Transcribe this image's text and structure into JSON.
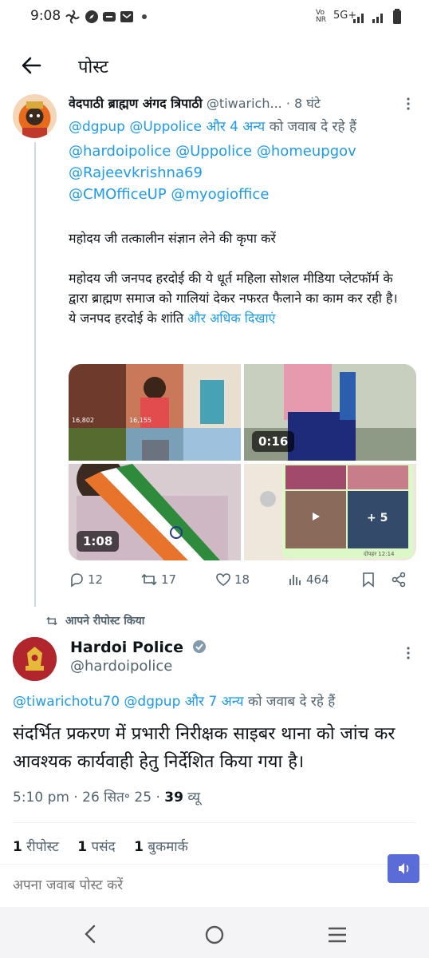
{
  "status_bar": {
    "time": "9:08",
    "network": "Vo\nNR",
    "signal_label": "5G+"
  },
  "header": {
    "title": "पोस्ट"
  },
  "tweet1": {
    "author_name": "वेदपाठी ब्राह्मण अंगद त्रिपाठी",
    "handle": "@tiwarich...",
    "time_ago": "· 8 घंटे",
    "replying_mentions": "@dgpup @Uppolice",
    "replying_more": "और 4 अन्य",
    "replying_suffix": "को जवाब दे रहे हैं",
    "mentions_line1": "@hardoipolice @Uppolice @homeupgov",
    "mentions_line2": "@Rajeevkrishna69",
    "mentions_line3": "@CMOfficeUP @myogioffice",
    "para1": "महोदय जी तत्कालीन संज्ञान लेने की कृपा करें",
    "para2": "महोदय जी जनपद हरदोई की ये धूर्त महिला सोशल मीडिया प्लेटफॉर्म के द्वारा ब्राह्मण समाज को गालियां देकर नफरत फैलाने का काम कर रही है।",
    "para3": "ये जनपद हरदोई के शांति",
    "show_more": "और अधिक दिखाएं",
    "media": {
      "video1_duration": "0:16",
      "video2_duration": "1:08",
      "thumb_views_a": "16,802",
      "thumb_views_b": "16,155",
      "chat_time": "दोपहर 12:14",
      "grid_more": "+ 5"
    },
    "stats": {
      "replies": "12",
      "reposts": "17",
      "likes": "18",
      "views": "464"
    }
  },
  "repost_label": "आपने रीपोस्ट किया",
  "tweet2": {
    "author_name": "Hardoi Police",
    "handle": "@hardoipolice",
    "replying_mentions": "@tiwarichotu70 @dgpup",
    "replying_more": "और 7 अन्य",
    "replying_suffix": "को जवाब दे रहे हैं",
    "body": "संदर्भित प्रकरण में प्रभारी निरीक्षक साइबर थाना को जांच कर आवश्यक कार्यवाही हेतु निर्देशित किया गया है।",
    "time": "5:10 pm",
    "date": "· 26 सित॰ 25 ·",
    "views_count": "39",
    "views_label": "व्यू",
    "reposts_count": "1",
    "reposts_label": "रीपोस्ट",
    "likes_count": "1",
    "likes_label": "पसंद",
    "bookmarks_count": "1",
    "bookmarks_label": "बुकमार्क"
  },
  "reply_box": {
    "placeholder": "अपना जवाब पोस्ट करें"
  },
  "colors": {
    "accent": "#1d9bf0",
    "muted": "#536471",
    "text": "#0f1419",
    "audio_button": "#5b6bd8"
  }
}
